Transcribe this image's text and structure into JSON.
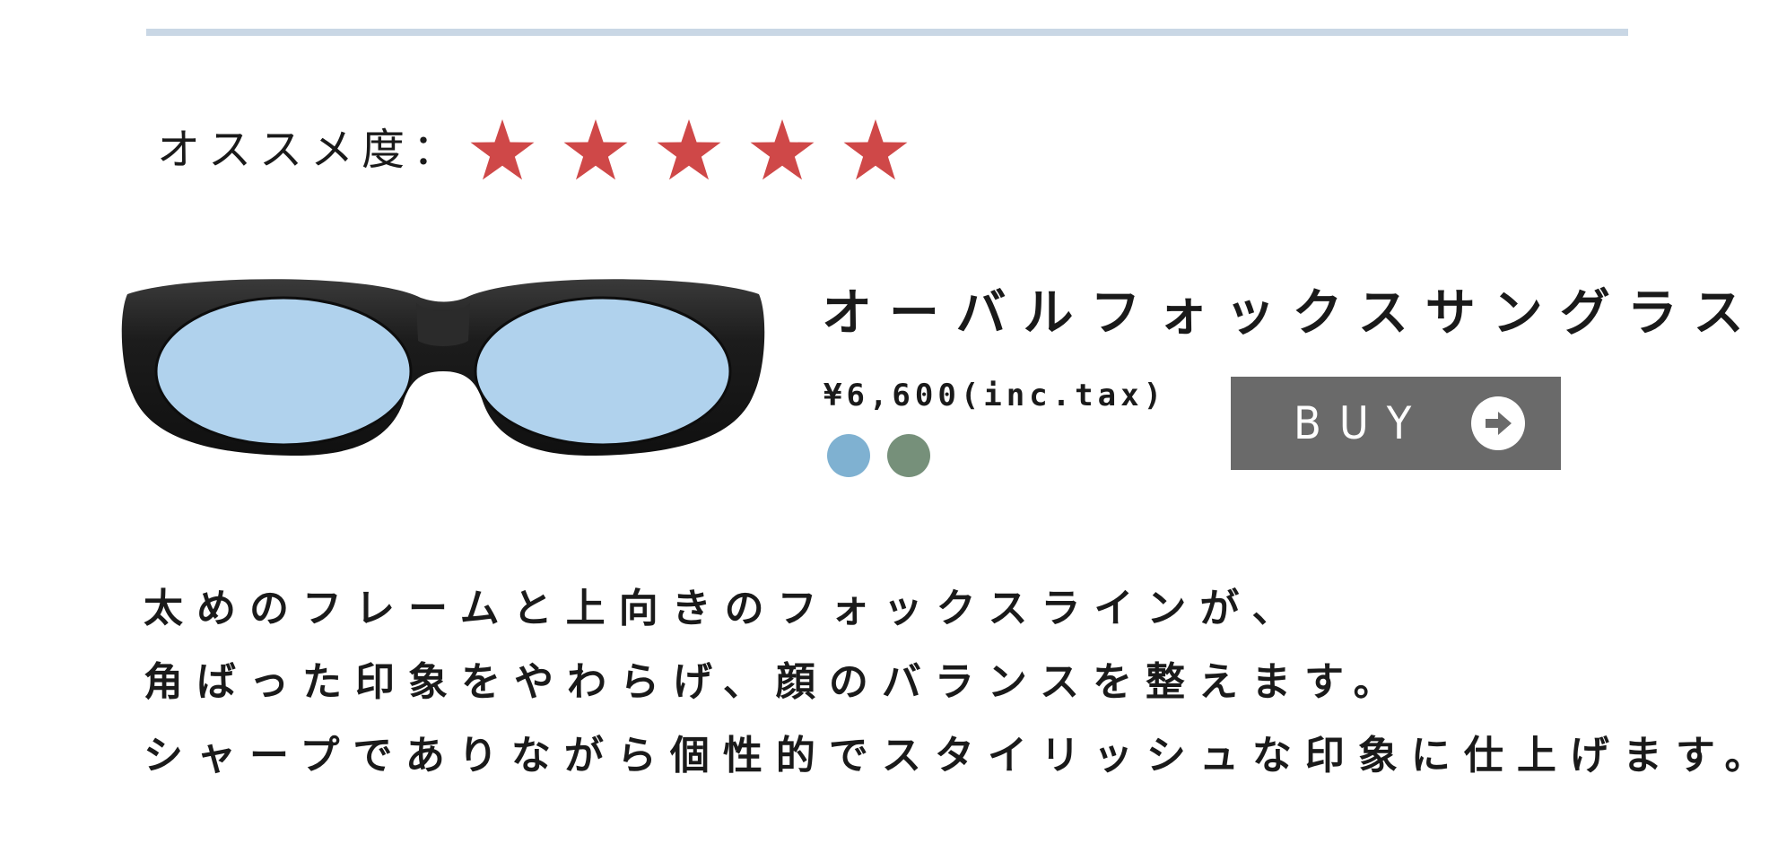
{
  "rating": {
    "label": "オススメ度：",
    "stars": 5,
    "max_stars": 5,
    "star_color": "#cf4848"
  },
  "product": {
    "name": "オーバルフォックスサングラス",
    "price": "¥6,600(inc.tax)",
    "image_icon": "sunglasses-icon",
    "colors": [
      {
        "color": "#7fb1d1"
      },
      {
        "color": "#76907a"
      }
    ]
  },
  "buy_button": {
    "label": "BUY",
    "icon": "arrow-right-circle-icon",
    "background": "#6a6a6a"
  },
  "description": {
    "lines": [
      "太めのフレームと上向きのフォックスラインが、",
      "角ばった印象をやわらげ、顔のバランスを整えます。",
      "シャープでありながら個性的でスタイリッシュな印象に仕上げます。"
    ]
  },
  "colors": {
    "divider": "#c9d7e5",
    "text": "#1a1a1a",
    "lens": "#b0d2ed",
    "frame": "#1f1f1f"
  }
}
